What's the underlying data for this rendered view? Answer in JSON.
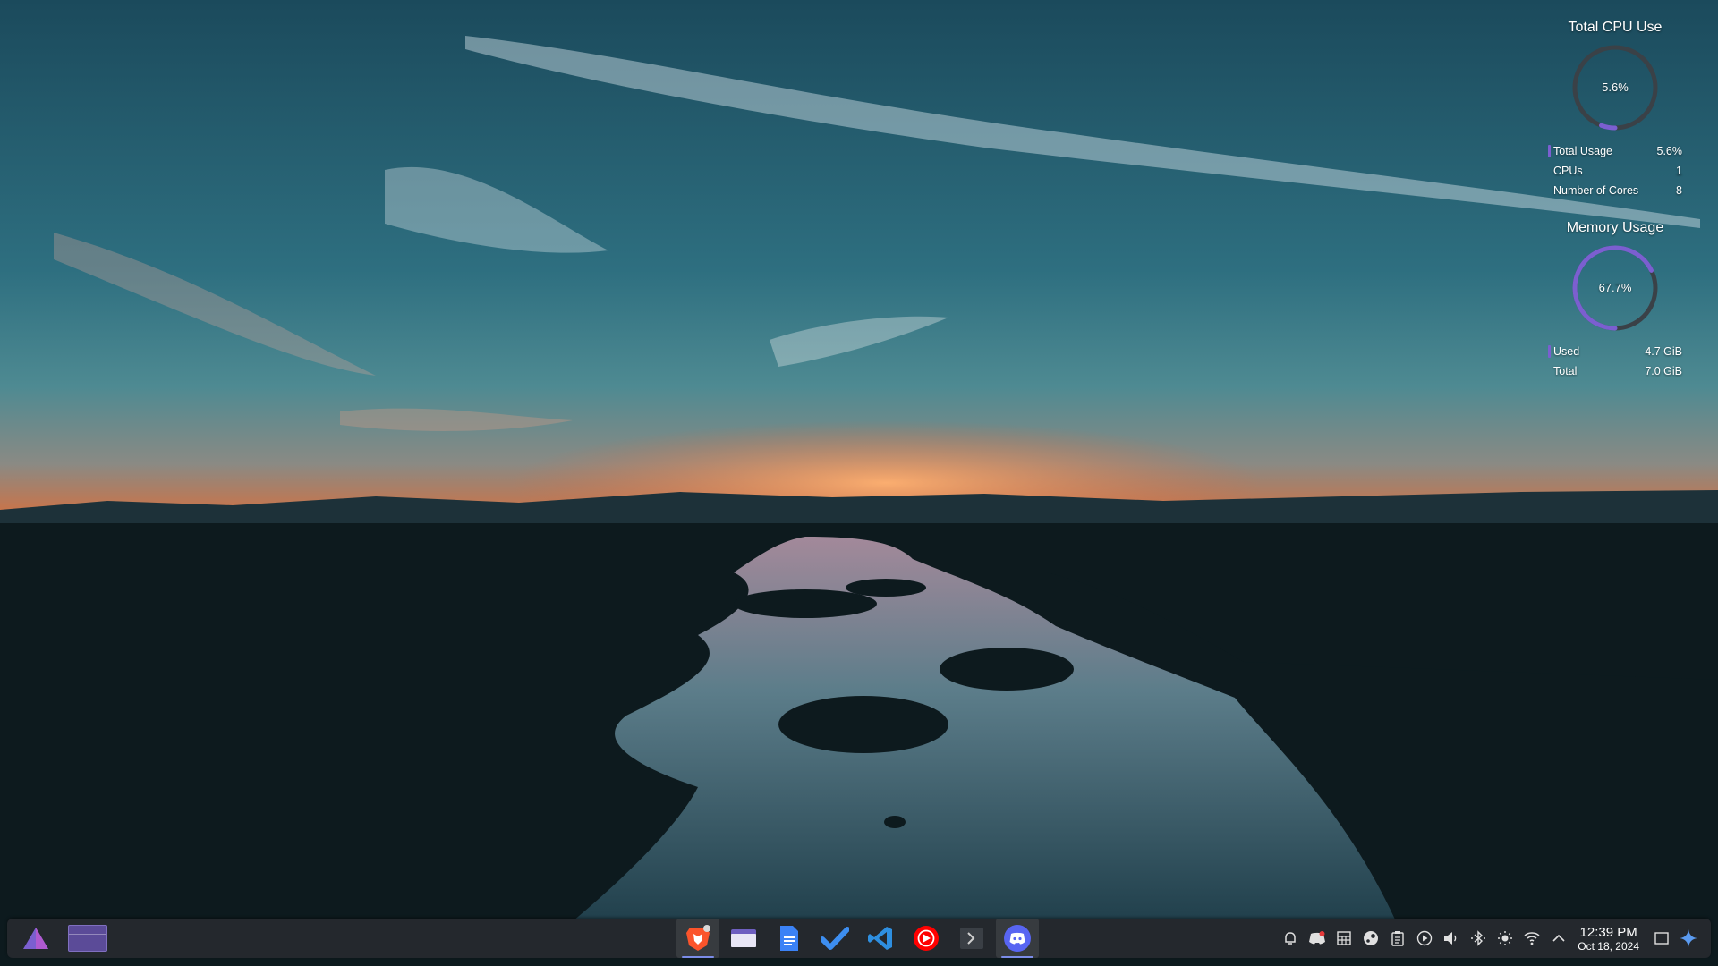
{
  "colors": {
    "accent": "#7b5fd0",
    "gauge_track": "#3a4147",
    "taskbar_bg": "#24282d"
  },
  "cpu_widget": {
    "title": "Total CPU Use",
    "gauge_value_text": "5.6%",
    "gauge_fraction": 0.056,
    "rows": [
      {
        "label": "Total Usage",
        "value": "5.6%",
        "swatch": true
      },
      {
        "label": "CPUs",
        "value": "1",
        "swatch": false
      },
      {
        "label": "Number of Cores",
        "value": "8",
        "swatch": false
      }
    ]
  },
  "memory_widget": {
    "title": "Memory Usage",
    "gauge_value_text": "67.7%",
    "gauge_fraction": 0.677,
    "rows": [
      {
        "label": "Used",
        "value": "4.7 GiB",
        "swatch": true
      },
      {
        "label": "Total",
        "value": "7.0 GiB",
        "swatch": false
      }
    ]
  },
  "taskbar": {
    "launcher_icon": "application-launcher-icon",
    "pinned_apps": [
      {
        "name": "brave-browser",
        "icon": "brave-icon",
        "active": true
      },
      {
        "name": "file-manager",
        "icon": "folder-icon",
        "active": false
      },
      {
        "name": "text-editor",
        "icon": "document-icon",
        "active": false
      },
      {
        "name": "tasks",
        "icon": "checkmark-icon",
        "active": false
      },
      {
        "name": "vscode",
        "icon": "vscode-icon",
        "active": false
      },
      {
        "name": "youtube-music",
        "icon": "youtube-music-icon",
        "active": false
      },
      {
        "name": "terminal",
        "icon": "terminal-icon",
        "active": false
      },
      {
        "name": "discord",
        "icon": "discord-icon",
        "active": true
      }
    ],
    "tray_icons": [
      "notifications-icon",
      "discord-tray-icon",
      "clipboard-grid-icon",
      "steam-icon",
      "clipboard-icon",
      "media-play-icon",
      "volume-icon",
      "bluetooth-icon",
      "brightness-icon",
      "wifi-icon",
      "chevron-up-icon"
    ],
    "clock": {
      "time": "12:39 PM",
      "date": "Oct 18, 2024"
    }
  }
}
